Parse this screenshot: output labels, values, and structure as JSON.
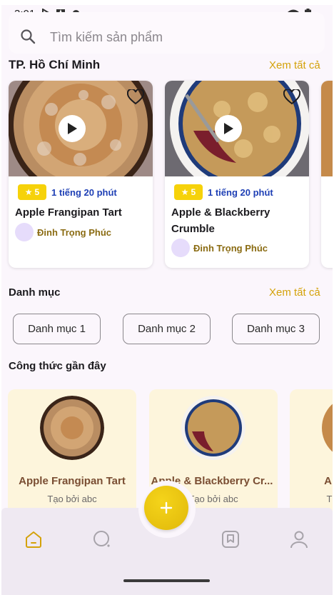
{
  "status_bar": {
    "time": "3:01",
    "icons": [
      "play-protect-icon",
      "text-a-icon",
      "cloud-icon",
      "wifi-icon",
      "battery-icon"
    ]
  },
  "search": {
    "placeholder": "Tìm kiếm sản phẩm",
    "icon": "search-icon"
  },
  "featured": {
    "title": "TP. Hồ Chí Minh",
    "see_all": "Xem tất cả",
    "cards": [
      {
        "name": "Apple Frangipan Tart",
        "rating": "5",
        "duration": "1 tiếng 20 phút",
        "author": "Đinh Trọng Phúc"
      },
      {
        "name": "Apple & Blackberry Crumble",
        "rating": "5",
        "duration": "1 tiếng 20 phút",
        "author": "Đinh Trọng Phúc"
      }
    ]
  },
  "categories": {
    "title": "Danh mục",
    "see_all": "Xem tất cả",
    "items": [
      "Danh mục 1",
      "Danh mục 2",
      "Danh mục 3"
    ]
  },
  "recent": {
    "title": "Công thức gần đây",
    "items": [
      {
        "name": "Apple Frangipan Tart",
        "by": "Tạo bởi abc"
      },
      {
        "name": "Apple & Blackberry Cr...",
        "by": "Tạo bởi abc"
      },
      {
        "name": "A",
        "by": "T"
      }
    ]
  },
  "bottom_nav": {
    "items": [
      "home-icon",
      "search-icon",
      "saved-icon",
      "profile-icon"
    ],
    "active": "home-icon",
    "fab_icon": "plus-icon"
  },
  "colors": {
    "accent": "#d4a20a",
    "fab": "#f0c814",
    "rating_badge": "#f6d20a",
    "duration_text": "#1f40b5",
    "author_text": "#8a6b12",
    "recent_card_bg": "#fdf5dc",
    "background": "#fbf6fc"
  }
}
